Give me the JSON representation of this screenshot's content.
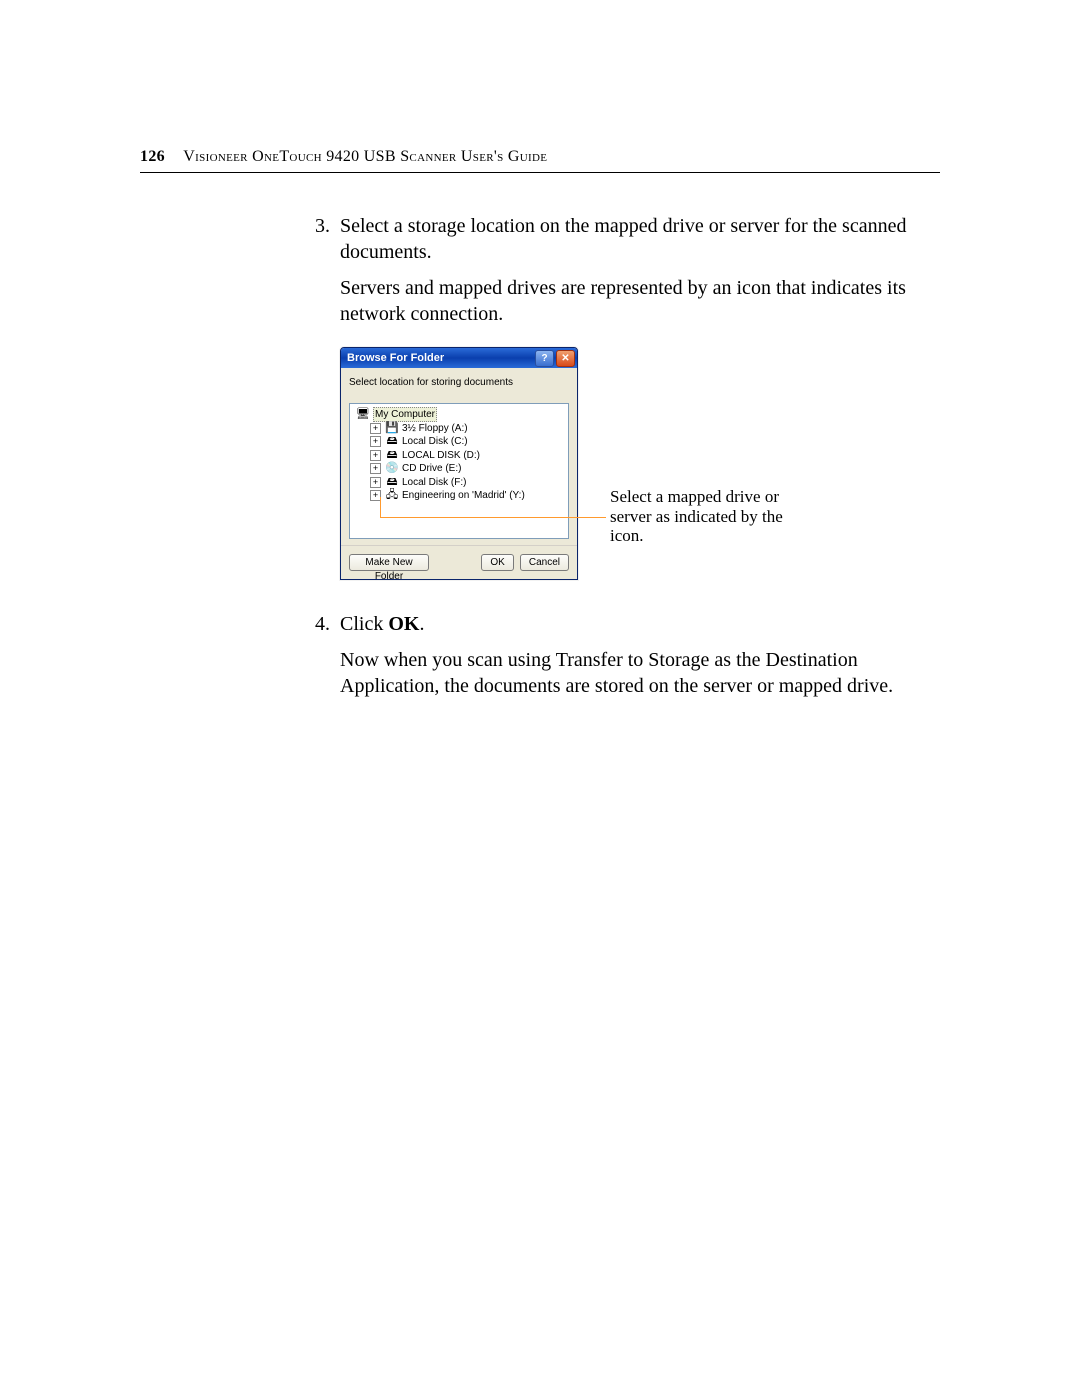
{
  "page": {
    "number": "126",
    "running_head": "Visioneer OneTouch 9420 USB Scanner User's Guide"
  },
  "steps": {
    "s3": {
      "num": "3.",
      "p1": "Select a storage location on the mapped drive or server for the scanned documents.",
      "p2": "Servers and mapped drives are represented by an icon that indicates its network connection."
    },
    "s4": {
      "num": "4.",
      "p1_pre": "Click ",
      "p1_bold": "OK",
      "p1_post": ".",
      "p2": "Now when you scan using Transfer to Storage as the Destination Application, the documents are stored on the server or mapped drive."
    }
  },
  "dialog": {
    "title": "Browse For Folder",
    "instruction": "Select location for storing documents",
    "tree": {
      "root_icon": "🖥",
      "root": "My Computer",
      "items": [
        {
          "icon": "💾",
          "label": "3½ Floppy (A:)"
        },
        {
          "icon": "🖴",
          "label": "Local Disk (C:)"
        },
        {
          "icon": "🖴",
          "label": "LOCAL DISK (D:)"
        },
        {
          "icon": "💿",
          "label": "CD Drive (E:)"
        },
        {
          "icon": "🖴",
          "label": "Local Disk (F:)"
        },
        {
          "icon": "🖧",
          "label": "Engineering on 'Madrid' (Y:)"
        }
      ]
    },
    "buttons": {
      "make_new_folder": "Make New Folder",
      "ok": "OK",
      "cancel": "Cancel"
    },
    "help_glyph": "?",
    "close_glyph": "✕"
  },
  "callout": "Select a mapped drive or server as indicated by the icon."
}
